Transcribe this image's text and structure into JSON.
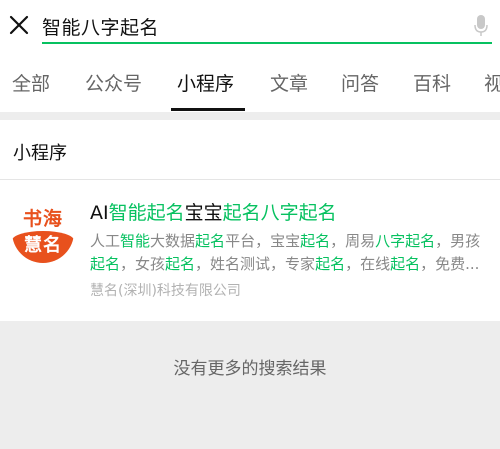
{
  "search": {
    "query": "智能八字起名"
  },
  "tabs": [
    {
      "label": "全部"
    },
    {
      "label": "公众号"
    },
    {
      "label": "小程序"
    },
    {
      "label": "文章"
    },
    {
      "label": "问答"
    },
    {
      "label": "百科"
    },
    {
      "label": "视"
    }
  ],
  "section": {
    "title": "小程序"
  },
  "result": {
    "logo_top": "书海",
    "logo_bottom": "慧名",
    "title_parts": [
      "AI",
      "智能起名",
      "宝宝",
      "起名八字起名"
    ],
    "desc_line1_parts": [
      "人工",
      "智能",
      "大数据",
      "起名",
      "平台，宝宝",
      "起名",
      "，周易",
      "八字起名",
      "，男孩"
    ],
    "desc_line2_parts": [
      "起名",
      "，女孩",
      "起名",
      "，姓名测试，专家",
      "起名",
      "，在线",
      "起名",
      "，免费..."
    ],
    "company": "慧名(深圳)科技有限公司"
  },
  "footer": {
    "no_more": "没有更多的搜索结果"
  },
  "colors": {
    "accent": "#07c160",
    "logo": "#e8511d"
  }
}
